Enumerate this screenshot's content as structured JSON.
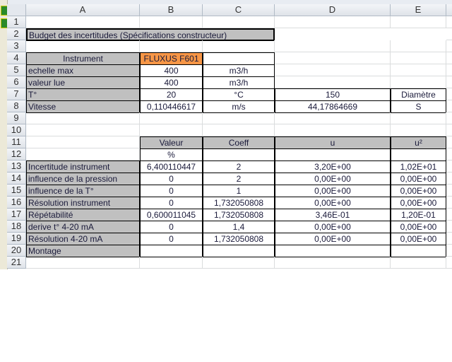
{
  "columns": [
    "A",
    "B",
    "C",
    "D",
    "E"
  ],
  "rows": [
    {
      "n": "1",
      "cells": [
        "",
        "",
        "",
        "",
        ""
      ]
    },
    {
      "n": "2",
      "cells": [
        "Budget des incertitudes (Spécifications constructeur)",
        "",
        "",
        "",
        ""
      ]
    },
    {
      "n": "3",
      "cells": [
        "",
        "",
        "",
        "",
        ""
      ]
    },
    {
      "n": "4",
      "cells": [
        "Instrument",
        "FLUXUS F601",
        "",
        "",
        ""
      ]
    },
    {
      "n": "5",
      "cells": [
        "echelle max",
        "400",
        "m3/h",
        "",
        ""
      ]
    },
    {
      "n": "6",
      "cells": [
        "valeur lue",
        "400",
        "m3/h",
        "",
        ""
      ]
    },
    {
      "n": "7",
      "cells": [
        "T°",
        "20",
        "°C",
        "150",
        "Diamètre"
      ]
    },
    {
      "n": "8",
      "cells": [
        "Vitesse",
        "0,110446617",
        "m/s",
        "44,17864669",
        "S"
      ]
    },
    {
      "n": "9",
      "cells": [
        "",
        "",
        "",
        "",
        ""
      ]
    },
    {
      "n": "10",
      "cells": [
        "",
        "",
        "",
        "",
        ""
      ]
    },
    {
      "n": "11",
      "cells": [
        "",
        "Valeur",
        "Coeff",
        "u",
        "u²"
      ]
    },
    {
      "n": "12",
      "cells": [
        "",
        "%",
        "",
        "",
        ""
      ]
    },
    {
      "n": "13",
      "cells": [
        "Incertitude instrument",
        "6,400110447",
        "2",
        "3,20E+00",
        "1,02E+01"
      ]
    },
    {
      "n": "14",
      "cells": [
        "influence de la pression",
        "0",
        "2",
        "0,00E+00",
        "0,00E+00"
      ]
    },
    {
      "n": "15",
      "cells": [
        "influence de la T°",
        "0",
        "1",
        "0,00E+00",
        "0,00E+00"
      ]
    },
    {
      "n": "16",
      "cells": [
        "Résolution instrument",
        "0",
        "1,732050808",
        "0,00E+00",
        "0,00E+00"
      ]
    },
    {
      "n": "17",
      "cells": [
        "Répétabilité",
        "0,600011045",
        "1,732050808",
        "3,46E-01",
        "1,20E-01"
      ]
    },
    {
      "n": "18",
      "cells": [
        "derive t° 4-20 mA",
        "0",
        "1,4",
        "0,00E+00",
        "0,00E+00"
      ]
    },
    {
      "n": "19",
      "cells": [
        "Résolution 4-20 mA",
        "0",
        "1,732050808",
        "0,00E+00",
        "0,00E+00"
      ]
    },
    {
      "n": "20",
      "cells": [
        "Montage",
        "",
        "",
        "",
        ""
      ]
    },
    {
      "n": "21",
      "cells": [
        "",
        "",
        "",
        "",
        ""
      ]
    }
  ],
  "colors": {
    "fill_gray": "#c0c0c0",
    "fill_orange": "#f79646"
  }
}
